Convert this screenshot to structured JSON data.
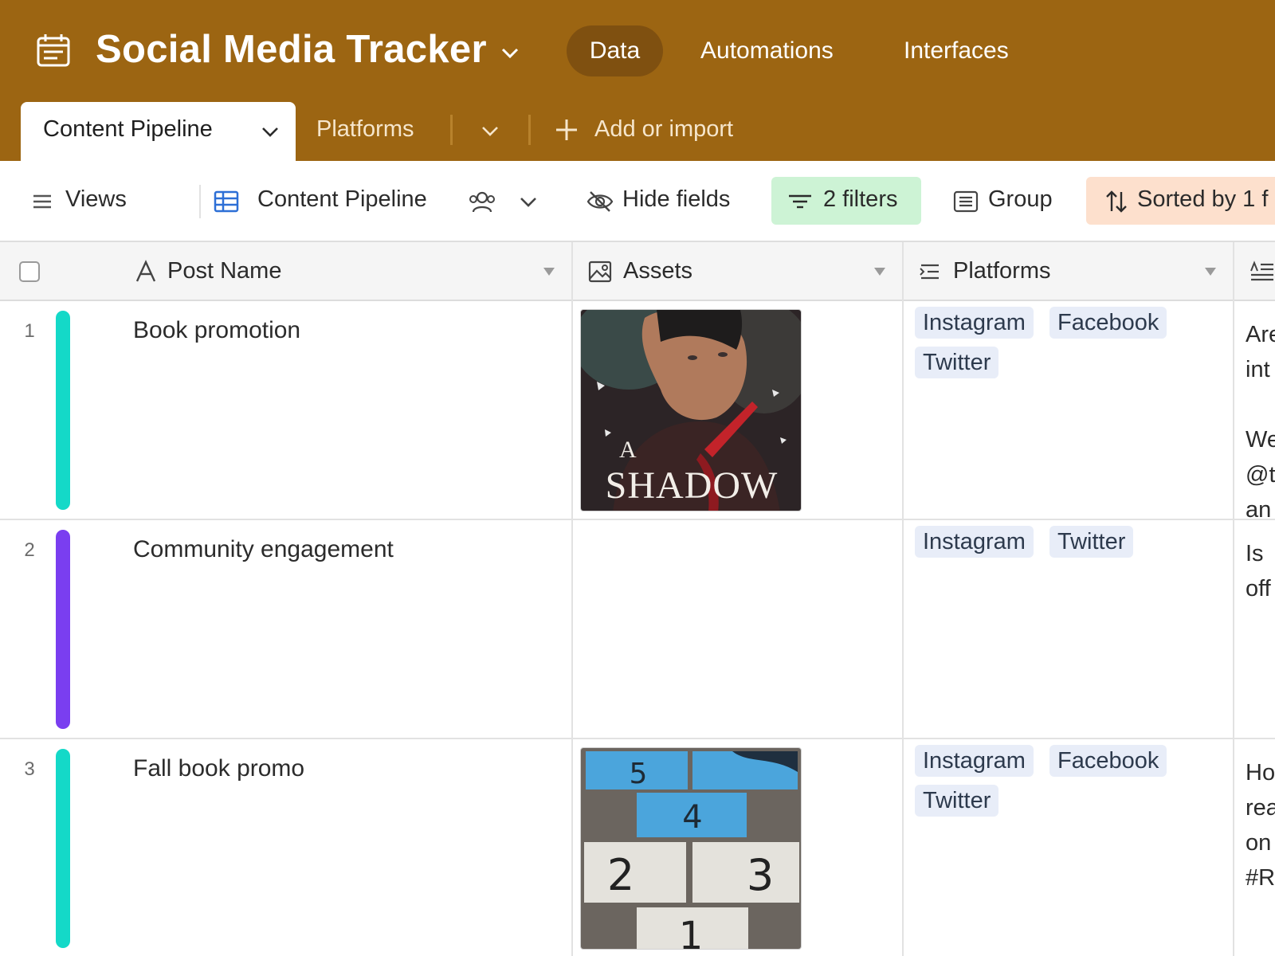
{
  "app": {
    "title": "Social Media Tracker",
    "nav": [
      "Data",
      "Automations",
      "Interfaces"
    ],
    "active_nav": "Data",
    "brand_color": "#9c6512"
  },
  "tables": {
    "active": "Content Pipeline",
    "second": "Platforms",
    "add_label": "Add or import"
  },
  "viewbar": {
    "views_label": "Views",
    "view_name": "Content Pipeline",
    "hide_fields": "Hide fields",
    "filters": "2 filters",
    "group": "Group",
    "sorted": "Sorted by 1 f"
  },
  "columns": {
    "post_name": "Post Name",
    "assets": "Assets",
    "platforms": "Platforms"
  },
  "rows": [
    {
      "number": "1",
      "color": "#14d9c8",
      "name": "Book promotion",
      "asset_text_a": "A",
      "asset_text_b": "SHADOW",
      "platforms": [
        "Instagram",
        "Facebook",
        "Twitter"
      ],
      "notes": [
        "Are",
        "int",
        "",
        "We",
        "@t",
        "an"
      ]
    },
    {
      "number": "2",
      "color": "#7a3ef0",
      "name": "Community engagement",
      "platforms": [
        "Instagram",
        "Twitter"
      ],
      "notes": [
        "Is",
        "off"
      ]
    },
    {
      "number": "3",
      "color": "#14d9c8",
      "name": "Fall book promo",
      "asset_numbers": [
        "5",
        "4",
        "2",
        "3",
        "1"
      ],
      "platforms": [
        "Instagram",
        "Facebook",
        "Twitter"
      ],
      "notes": [
        "Ho",
        "rea",
        "on",
        "#R"
      ]
    }
  ]
}
